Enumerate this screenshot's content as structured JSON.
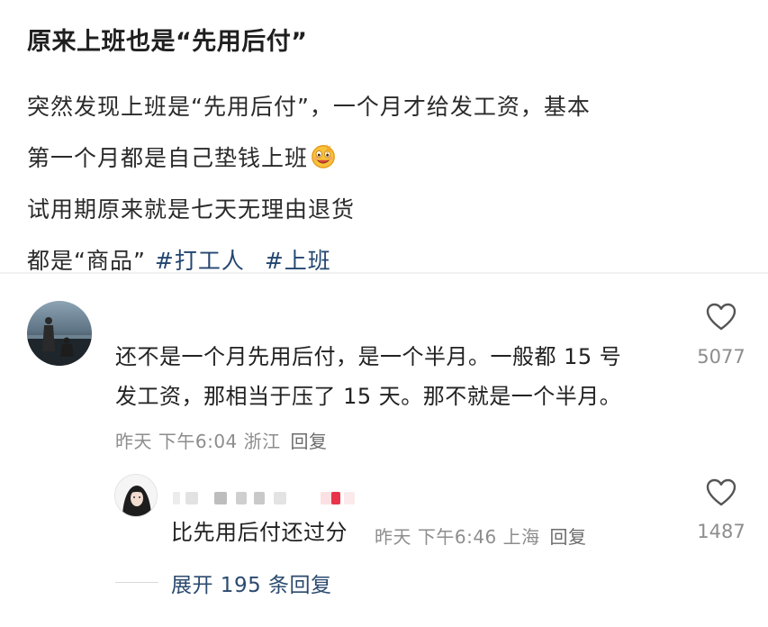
{
  "post": {
    "title": "原来上班也是“先用后付”",
    "lines": [
      "突然发现上班是“先用后付”，一个月才给发工资，基本",
      "第一个月都是自己垫钱上班",
      "试用期原来就是七天无理由退货",
      "都是“商品”"
    ],
    "emoji": "money-face-emoji",
    "tags": [
      "#打工人",
      "#上班"
    ]
  },
  "comments": [
    {
      "text_lines": [
        "还不是一个月先用后付，是一个半月。一般都 15 号",
        "发工资，那相当于压了 15 天。那不就是一个半月。"
      ],
      "meta": "昨天 下午6:04 浙江",
      "reply_label": "回复",
      "likes": "5077",
      "replies": [
        {
          "text": "比先用后付还过分",
          "meta": "昨天 下午6:46 上海",
          "reply_label": "回复",
          "likes": "1487"
        }
      ]
    }
  ],
  "expand_label": "展开 195 条回复",
  "icons": {
    "like": "heart-outline-icon"
  },
  "colors": {
    "accent": "#23466f",
    "meta": "#8d8d8d",
    "blurred": "#d9d9d9",
    "blurred_pink": "#e8334a"
  }
}
